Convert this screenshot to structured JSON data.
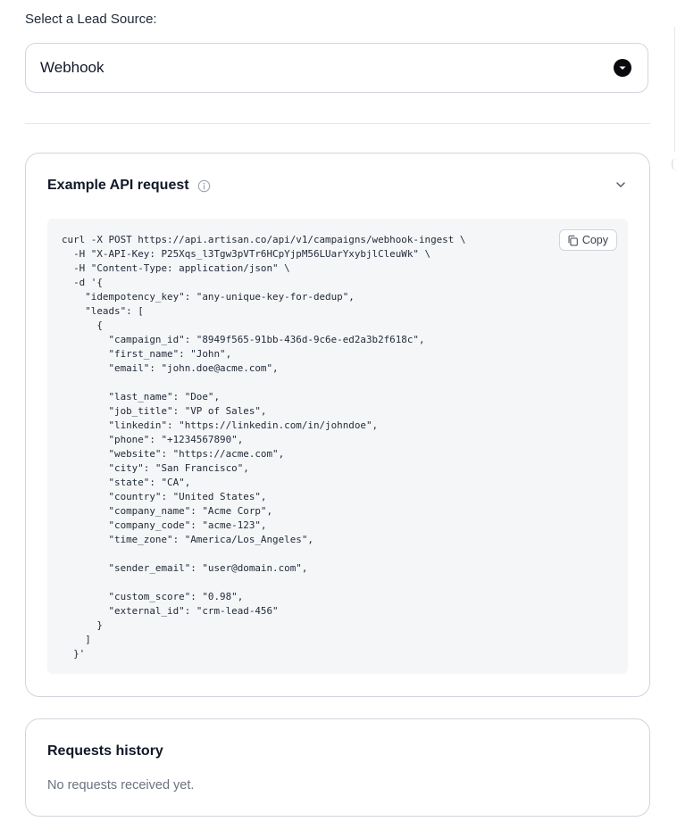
{
  "lead_source": {
    "label": "Select a Lead Source:",
    "selected": "Webhook"
  },
  "api_card": {
    "title": "Example API request",
    "copy_label": "Copy",
    "code": "curl -X POST https://api.artisan.co/api/v1/campaigns/webhook-ingest \\\n  -H \"X-API-Key: P25Xqs_l3Tgw3pVTr6HCpYjpM56LUarYxybjlCleuWk\" \\\n  -H \"Content-Type: application/json\" \\\n  -d '{\n    \"idempotency_key\": \"any-unique-key-for-dedup\",\n    \"leads\": [\n      {\n        \"campaign_id\": \"8949f565-91bb-436d-9c6e-ed2a3b2f618c\",\n        \"first_name\": \"John\",\n        \"email\": \"john.doe@acme.com\",\n\n        \"last_name\": \"Doe\",\n        \"job_title\": \"VP of Sales\",\n        \"linkedin\": \"https://linkedin.com/in/johndoe\",\n        \"phone\": \"+1234567890\",\n        \"website\": \"https://acme.com\",\n        \"city\": \"San Francisco\",\n        \"state\": \"CA\",\n        \"country\": \"United States\",\n        \"company_name\": \"Acme Corp\",\n        \"company_code\": \"acme-123\",\n        \"time_zone\": \"America/Los_Angeles\",\n\n        \"sender_email\": \"user@domain.com\",\n\n        \"custom_score\": \"0.98\",\n        \"external_id\": \"crm-lead-456\"\n      }\n    ]\n  }'"
  },
  "history_card": {
    "title": "Requests history",
    "empty_message": "No requests received yet."
  },
  "icons": {
    "select": "chevron-down-circle-icon",
    "info": "info-icon",
    "collapse": "chevron-down-icon",
    "copy": "copy-icon"
  }
}
